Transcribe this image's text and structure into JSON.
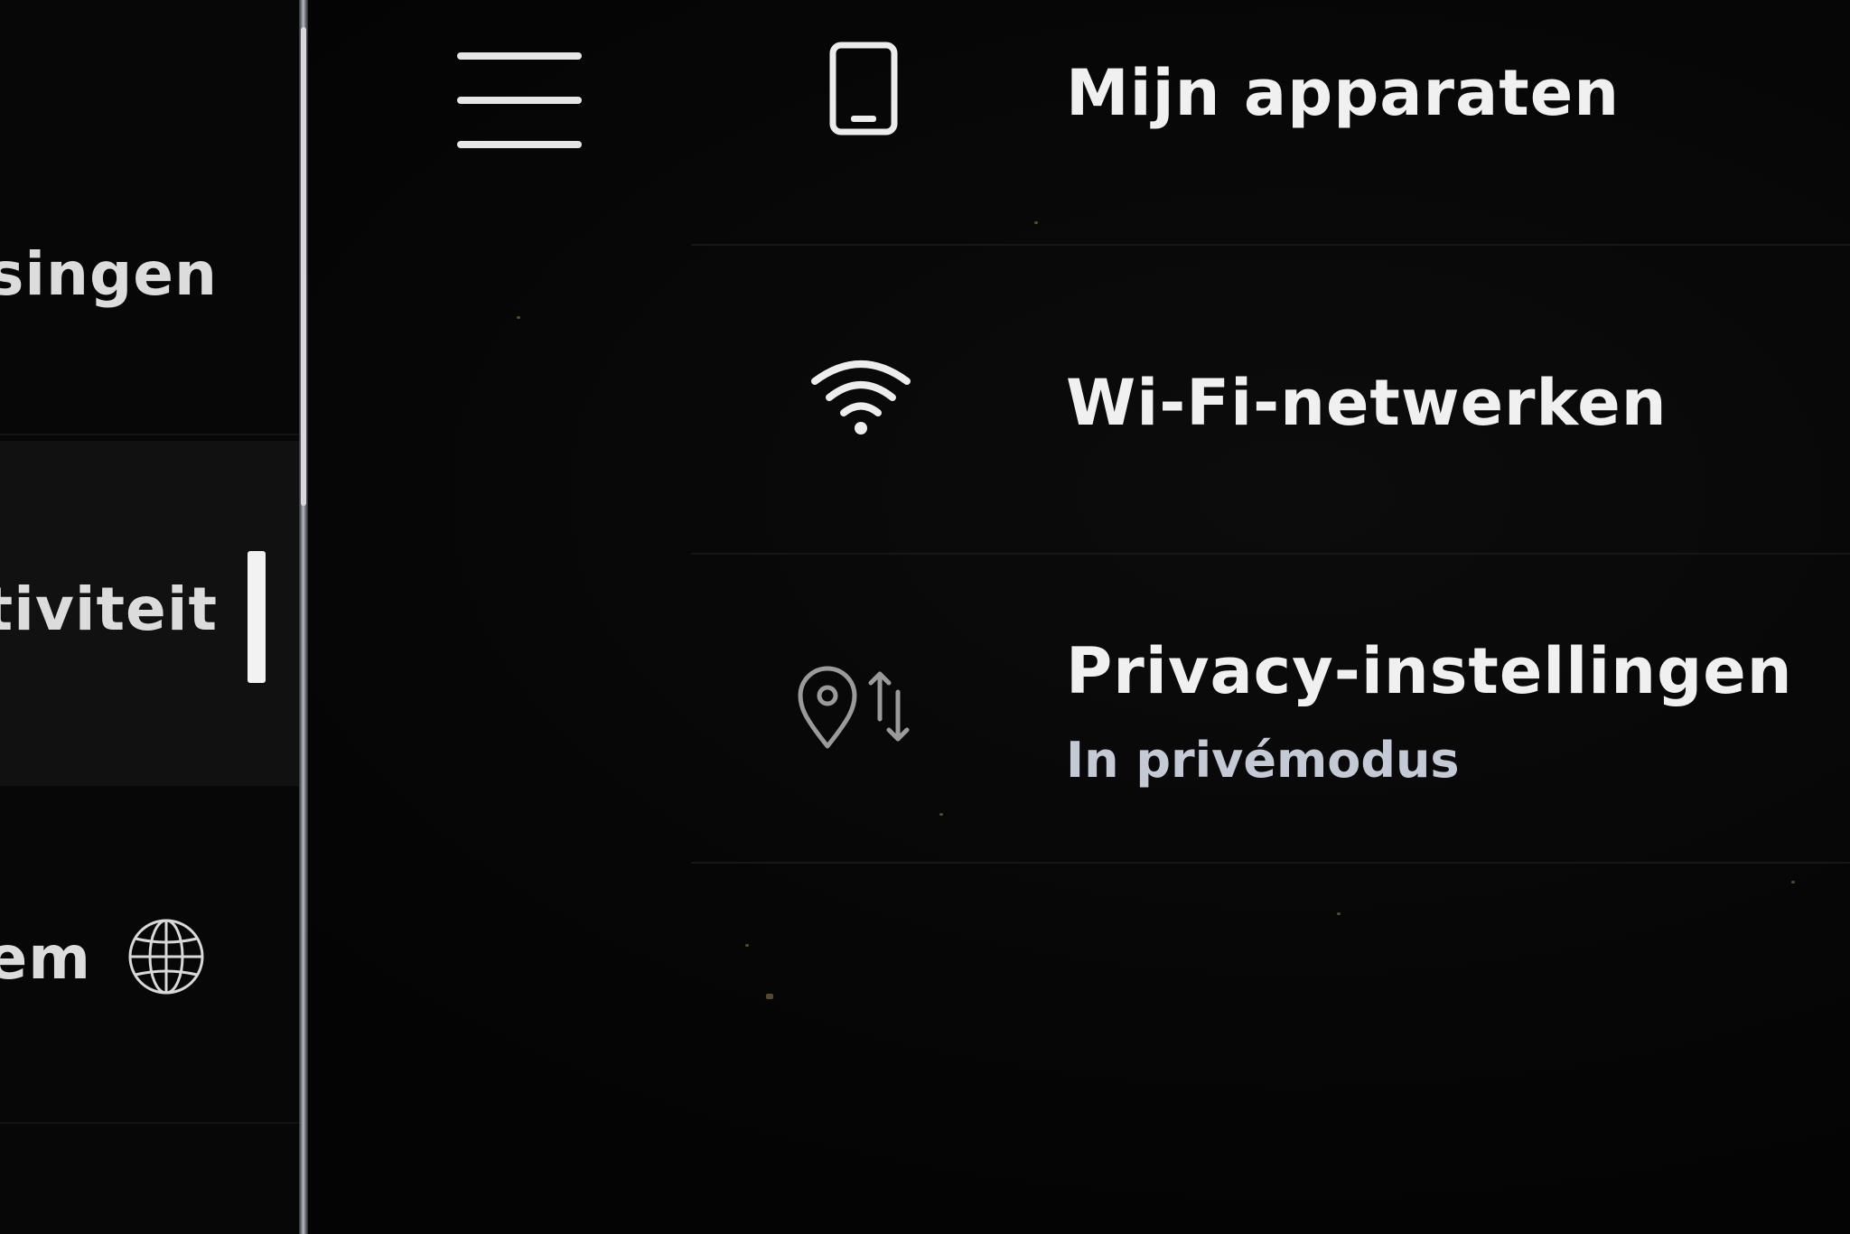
{
  "sidebar": {
    "items": [
      {
        "label": "singen"
      },
      {
        "label": "ctiviteit"
      },
      {
        "label": "em"
      }
    ],
    "active_index": 1
  },
  "header": {
    "menu_icon": "hamburger-menu-icon"
  },
  "main": {
    "items": [
      {
        "icon": "phone-icon",
        "title": "Mijn apparaten"
      },
      {
        "icon": "wifi-icon",
        "title": "Wi-Fi-netwerken"
      },
      {
        "icon": "location-data-icon",
        "title": "Privacy-instellingen",
        "subtitle": "In privémodus"
      }
    ]
  },
  "colors": {
    "background": "#050505",
    "text": "#f0f0f0",
    "subtitle": "#c3cad6",
    "accent": "#f2f2f2"
  }
}
